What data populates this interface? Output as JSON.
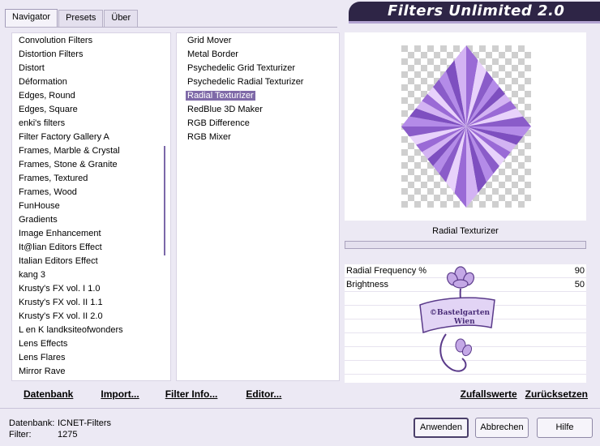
{
  "tabs": [
    "Navigator",
    "Presets",
    "Über"
  ],
  "header": {
    "title": "Filters Unlimited 2.0"
  },
  "categories": [
    "Convolution Filters",
    "Distortion Filters",
    "Distort",
    "Déformation",
    "Edges, Round",
    "Edges, Square",
    "enki's filters",
    "Filter Factory Gallery A",
    "Frames, Marble & Crystal",
    "Frames, Stone & Granite",
    "Frames, Textured",
    "Frames, Wood",
    "FunHouse",
    "Gradients",
    "Image Enhancement",
    "It@lian Editors Effect",
    "Italian Editors Effect",
    "kang 3",
    "Krusty's FX vol. I 1.0",
    "Krusty's FX vol. II 1.1",
    "Krusty's FX vol. II 2.0",
    "L en K landksiteofwonders",
    "Lens Effects",
    "Lens Flares",
    "Mirror Rave"
  ],
  "filters": [
    "Grid Mover",
    "Metal Border",
    "Psychedelic Grid Texturizer",
    "Psychedelic Radial Texturizer",
    "Radial Texturizer",
    "RedBlue 3D Maker",
    "RGB Difference",
    "RGB Mixer"
  ],
  "selected_filter": "Radial Texturizer",
  "preview_title": "Radial Texturizer",
  "params": [
    {
      "name": "Radial Frequency %",
      "value": "90"
    },
    {
      "name": "Brightness",
      "value": "50"
    }
  ],
  "watermark": {
    "line1": "©Bastelgarten",
    "line2": "Wien"
  },
  "list_buttons": {
    "database": "Datenbank",
    "import": "Import...",
    "filter_info": "Filter Info...",
    "editor": "Editor..."
  },
  "preset_buttons": {
    "random": "Zufallswerte",
    "reset": "Zurücksetzen"
  },
  "status": {
    "database_label": "Datenbank:",
    "database_value": "ICNET-Filters",
    "filter_label": "Filter:",
    "filter_value": "1275"
  },
  "dialog_buttons": {
    "apply": "Anwenden",
    "cancel": "Abbrechen",
    "help": "Hilfe"
  },
  "colors": {
    "accent": "#7f6aa8",
    "header_bg": "#2e2546",
    "diamond": "#a67ee0"
  }
}
